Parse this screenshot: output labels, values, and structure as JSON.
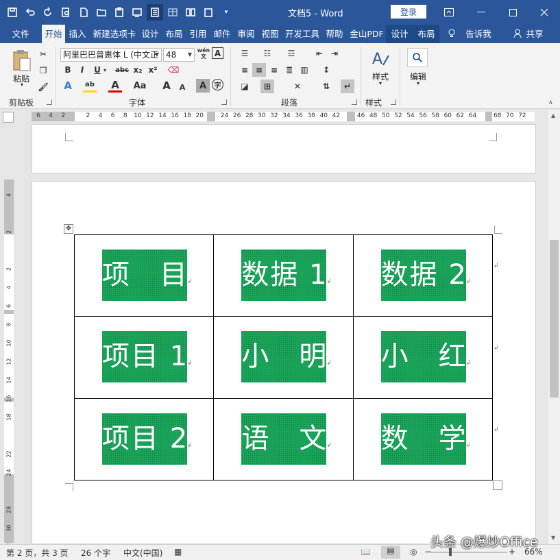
{
  "titlebar": {
    "doc_title": "文档5 - Word",
    "login": "登录",
    "quick_access": [
      "save-icon",
      "undo-icon",
      "redo-icon",
      "print-preview-icon",
      "new-doc-icon",
      "open-folder-icon",
      "paste-special-icon",
      "screenshot-icon",
      "reading-view-icon",
      "table-icon",
      "columns-icon",
      "clipboard-icon",
      "more-icon"
    ],
    "window_controls": [
      "ribbon-display-icon",
      "minimize-icon",
      "maximize-icon",
      "close-icon"
    ]
  },
  "tabs": {
    "file": "文件",
    "home": "开始",
    "insert": "插入",
    "new_tab": "新建选项卡",
    "design": "设计",
    "layout": "布局",
    "references": "引用",
    "mailings": "邮件",
    "review": "审阅",
    "view": "视图",
    "developer": "开发工具",
    "help": "帮助",
    "pdf": "金山PDF",
    "table_design": "设计",
    "table_layout": "布局",
    "tell_me": "告诉我",
    "share": "共享"
  },
  "ribbon": {
    "paste": "粘贴",
    "clipboard_group": "剪贴板",
    "font_name": "阿里巴巴普惠体 L (中文正",
    "font_size": "48",
    "font_group": "字体",
    "paragraph_group": "段落",
    "styles": "样式",
    "styles_group": "样式",
    "editing": "编辑",
    "bold": "B",
    "italic": "I",
    "underline": "U",
    "strike": "abc",
    "subscript": "x₂",
    "superscript": "x²",
    "text_effect": "A",
    "font_color": "A",
    "change_case": "Aa",
    "grow_font": "A",
    "shrink_font": "A",
    "char_shading": "A",
    "enclose": "字",
    "phonetic": "wén",
    "char_border": "A"
  },
  "ruler": {
    "numbers": [
      "6",
      "4",
      "2",
      "",
      "2",
      "4",
      "6",
      "8",
      "10",
      "12",
      "14",
      "16",
      "18",
      "20",
      "",
      "24",
      "26",
      "28",
      "30",
      "32",
      "34",
      "36",
      "38",
      "40",
      "42",
      "",
      "46",
      "48",
      "50",
      "52",
      "54",
      "56",
      "58",
      "60",
      "62",
      "64",
      "",
      "68",
      "70",
      "72"
    ],
    "vertical_numbers": [
      "4",
      "",
      "2",
      "",
      "2",
      "4",
      "6",
      "8",
      "10",
      "12",
      "14",
      "16",
      "18",
      "",
      "22",
      "24",
      "",
      "28",
      "30",
      "32"
    ]
  },
  "table": {
    "rows": [
      [
        "项　目",
        "数据 1",
        "数据 2"
      ],
      [
        "项目 1",
        "小　明",
        "小　红"
      ],
      [
        "项目 2",
        "语　文",
        "数　学"
      ]
    ],
    "cell_fill": "#1aa55a",
    "text_color": "#ffffff"
  },
  "statusbar": {
    "page": "第 2 页，共 3 页",
    "words": "26 个字",
    "language": "中文(中国)",
    "zoom": "66%",
    "zoom_out": "−",
    "zoom_in": "+",
    "zoom_value": 0.66
  },
  "watermark": "头条 @爆炒Office",
  "colors": {
    "accent": "#2b579a",
    "cell_green": "#1aa55a"
  }
}
